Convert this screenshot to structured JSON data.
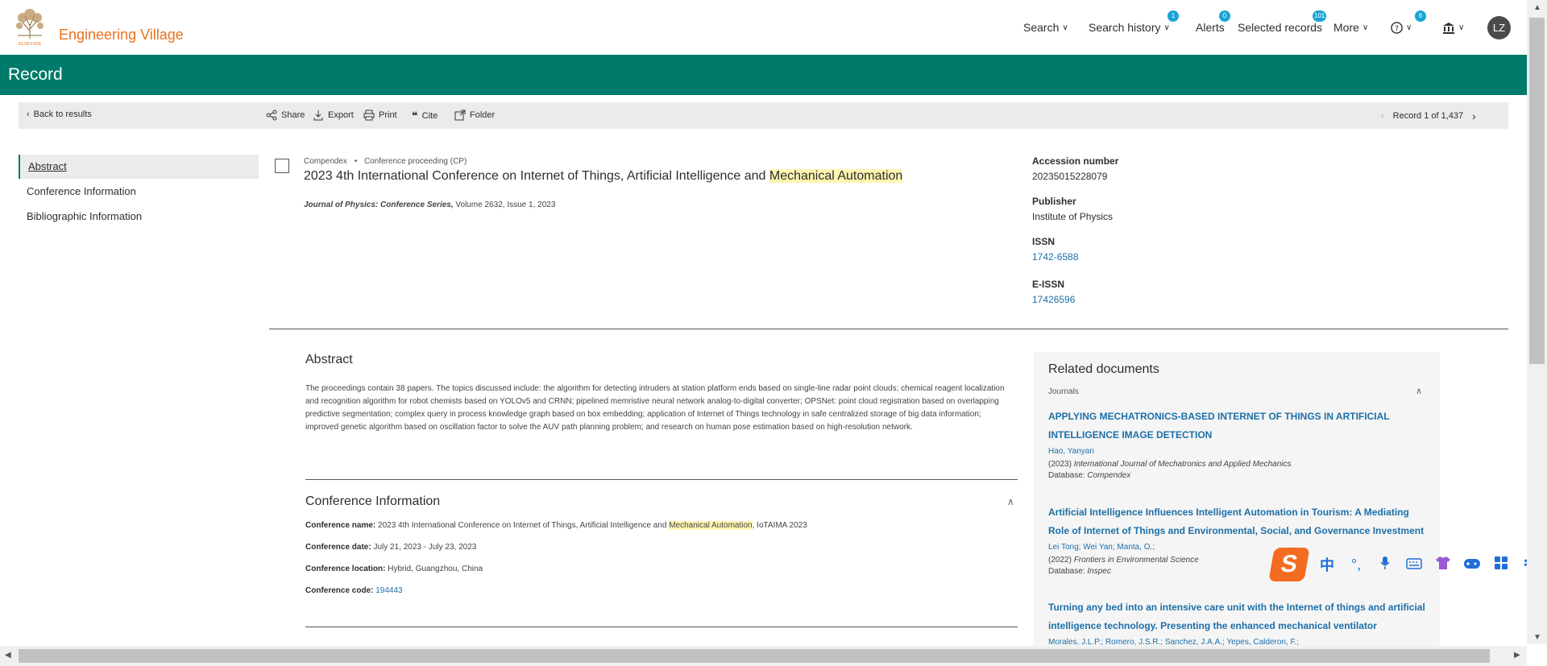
{
  "header": {
    "logo_text": "ELSEVIER",
    "brand": "Engineering Village",
    "nav": {
      "search": "Search",
      "search_history": "Search history",
      "search_history_badge": "1",
      "alerts": "Alerts",
      "alerts_badge": "0",
      "selected_records": "Selected records",
      "selected_records_badge": "101",
      "more": "More",
      "help_badge": "6"
    },
    "avatar_initials": "LZ"
  },
  "page_title": "Record",
  "toolbar": {
    "back": "Back to results",
    "share": "Share",
    "export": "Export",
    "print": "Print",
    "cite": "Cite",
    "folder": "Folder",
    "record_counter": "Record 1 of 1,437"
  },
  "leftnav": {
    "items": [
      "Abstract",
      "Conference Information",
      "Bibliographic Information"
    ]
  },
  "record": {
    "database": "Compendex",
    "bullet": "•",
    "doctype": "Conference proceeding (CP)",
    "title_part1": "2023 4th International Conference on Internet of Things, Artificial Intelligence and ",
    "title_highlight": "Mechanical Automation",
    "journal_name": "Journal of Physics: Conference Series,",
    "journal_details": " Volume 2632, Issue 1, 2023"
  },
  "info": {
    "accession_label": "Accession number",
    "accession_value": "20235015228079",
    "publisher_label": "Publisher",
    "publisher_value": "Institute of Physics",
    "issn_label": "ISSN",
    "issn_value": "1742-6588",
    "eissn_label": "E-ISSN",
    "eissn_value": "17426596"
  },
  "abstract": {
    "heading": "Abstract",
    "text": "The proceedings contain 38 papers. The topics discussed include: the algorithm for detecting intruders at station platform ends based on single-line radar point clouds; chemical reagent localization and recognition algorithm for robot chemists based on YOLOv5 and CRNN; pipelined memristive neural network analog-to-digital converter; OPSNet: point cloud registration based on overlapping predictive segmentation; complex query in process knowledge graph based on box embedding; application of Internet of Things technology in safe centralized storage of big data information; improved genetic algorithm based on oscillation factor to solve the AUV path planning problem; and research on human pose estimation based on high-resolution network."
  },
  "conference": {
    "heading": "Conference Information",
    "name_label": "Conference name:",
    "name_part1": " 2023 4th International Conference on Internet of Things, Artificial Intelligence and ",
    "name_highlight": "Mechanical Automation",
    "name_part2": ", IoTAIMA 2023",
    "date_label": "Conference date:",
    "date_value": " July 21, 2023 - July 23, 2023",
    "location_label": "Conference location:",
    "location_value": " Hybrid, Guangzhou, China",
    "code_label": "Conference code:",
    "code_value": "194443"
  },
  "related": {
    "heading": "Related documents",
    "sub": "Journals",
    "docs": [
      {
        "title": "APPLYING MECHATRONICS-BASED INTERNET OF THINGS IN ARTIFICIAL INTELLIGENCE IMAGE DETECTION",
        "authors": "Hao, Yanyan",
        "year": "(2023)",
        "source": "International Journal of Mechatronics and Applied Mechanics",
        "db_label": "Database:",
        "db": "Compendex"
      },
      {
        "title": "Artificial Intelligence Influences Intelligent Automation in Tourism: A Mediating Role of Internet of Things and Environmental, Social, and Governance Investment",
        "authors": "Lei Tong;  Wei Yan;  Manta, O.;",
        "year": "(2022)",
        "source": "Frontiers in Environmental Science",
        "db_label": "Database:",
        "db": "Inspec"
      },
      {
        "title": "Turning any bed into an intensive care unit with the Internet of things and artificial intelligence technology. Presenting the enhanced mechanical ventilator",
        "authors": "Morales, J.L.P.; Romero, J.S.R.; Sanchez, J.A.A.; Yepes, Calderon, F.;",
        "year": "",
        "source": "",
        "db_label": "",
        "db": ""
      }
    ]
  },
  "ime": {
    "logo": "S",
    "lang": "中",
    "punct": "°,"
  }
}
